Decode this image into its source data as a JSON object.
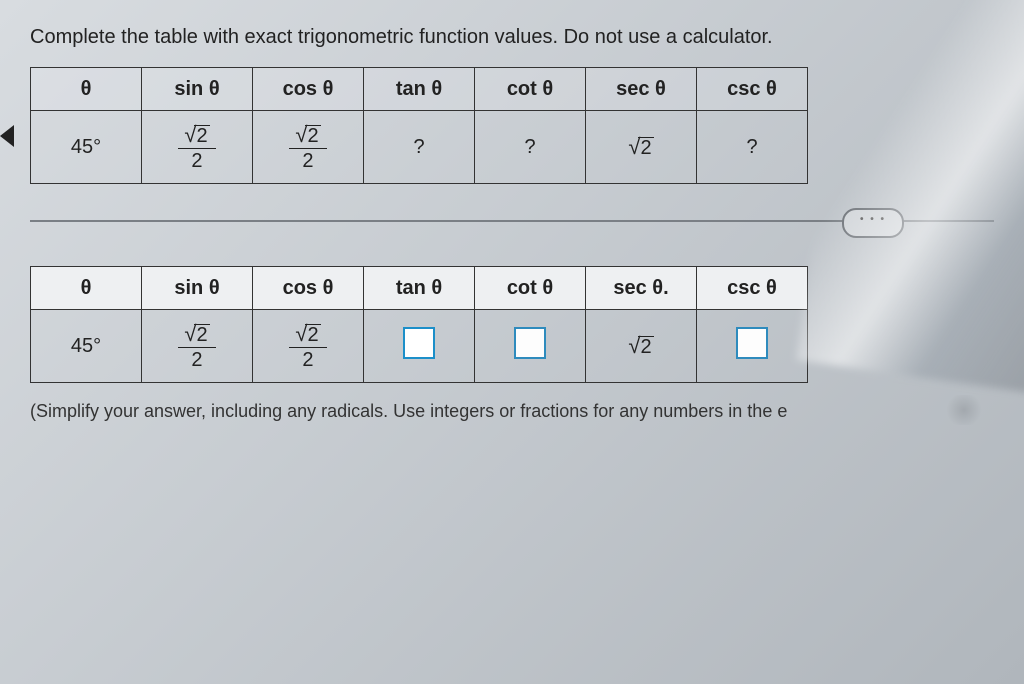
{
  "instruction": "Complete the table with exact trigonometric function values. Do not use a calculator.",
  "headers": {
    "theta": "θ",
    "sin": "sin θ",
    "cos": "cos θ",
    "tan": "tan θ",
    "cot": "cot θ",
    "sec": "sec θ",
    "csc": "csc θ"
  },
  "row1": {
    "theta": "45°",
    "sin_num_rad": "2",
    "sin_den": "2",
    "cos_num_rad": "2",
    "cos_den": "2",
    "tan": "?",
    "cot": "?",
    "sec_rad": "2",
    "csc": "?"
  },
  "ellipsis": "• • •",
  "headers2": {
    "theta": "θ",
    "sin": "sin θ",
    "cos": "cos θ",
    "tan": "tan θ",
    "cot": "cot θ",
    "sec": "sec θ.",
    "csc": "csc θ"
  },
  "row2": {
    "theta": "45°",
    "sin_num_rad": "2",
    "sin_den": "2",
    "cos_num_rad": "2",
    "cos_den": "2",
    "sec_rad": "2"
  },
  "help": "(Simplify your answer, including any radicals. Use integers or fractions for any numbers in the e"
}
